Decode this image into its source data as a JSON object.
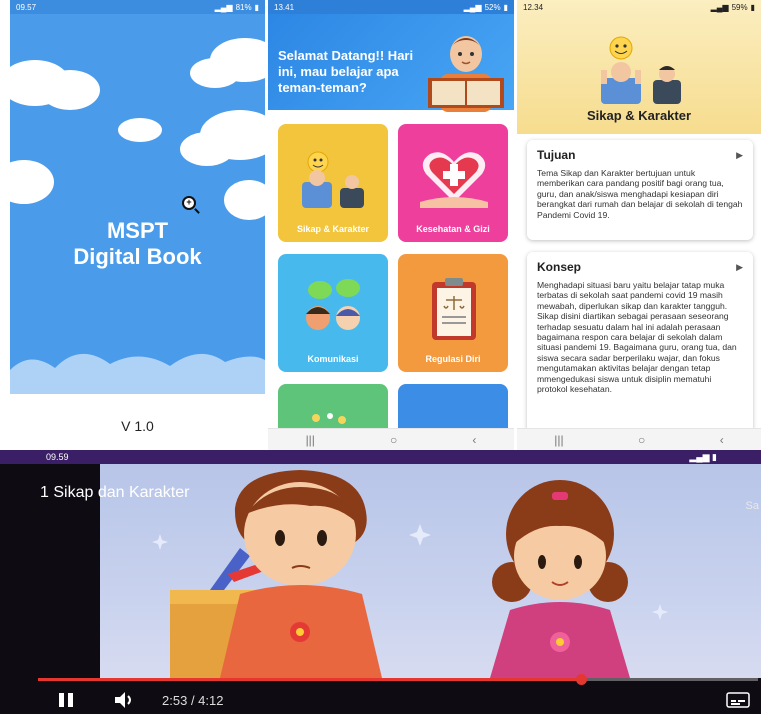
{
  "splash": {
    "status_time": "09.57",
    "status_right": "81%",
    "title_line1": "MSPT",
    "title_line2": "Digital Book",
    "version": "V 1.0"
  },
  "home": {
    "status_time": "13.41",
    "status_right": "52%",
    "greeting": "Selamat Datang!! Hari ini, mau belajar apa teman-teman?",
    "cards": [
      {
        "label": "Sikap & Karakter",
        "color": "#f2c53d"
      },
      {
        "label": "Kesehatan & Gizi",
        "color": "#ef3f9d"
      },
      {
        "label": "Komunikasi",
        "color": "#47b9ec"
      },
      {
        "label": "Regulasi Diri",
        "color": "#f39a3e"
      },
      {
        "label": "",
        "color": "#5ec47a"
      },
      {
        "label": "",
        "color": "#3b8de6"
      }
    ]
  },
  "detail": {
    "status_time": "12.34",
    "status_right": "59%",
    "title": "Sikap & Karakter",
    "sections": [
      {
        "heading": "Tujuan",
        "body": "Tema Sikap dan Karakter bertujuan untuk memberikan cara pandang positif bagi orang tua, guru, dan anak/siswa menghadapi kesiapan diri berangkat dari rumah dan belajar di sekolah di tengah Pandemi Covid 19."
      },
      {
        "heading": "Konsep",
        "body": "Menghadapi situasi baru yaitu belajar tatap muka terbatas di sekolah saat pandemi covid 19 masih mewabah, diperlukan sikap dan karakter tangguh. Sikap disini diartikan sebagai perasaan seseorang terhadap sesuatu dalam hal ini adalah perasaan bagaimana respon cara belajar di sekolah dalam situasi pandemi 19. Bagaimana guru, orang tua, dan siswa secara sadar berperilaku wajar, dan fokus mengutamakan aktivitas belajar dengan tetap mmengedukasi siswa untuk disiplin mematuhi protokol kesehatan."
      }
    ]
  },
  "video": {
    "status_time": "09.59",
    "title": "1 Sikap dan Karakter",
    "title_right": "Sa",
    "current_time": "2:53",
    "duration": "4:12",
    "progress": 0.754
  }
}
